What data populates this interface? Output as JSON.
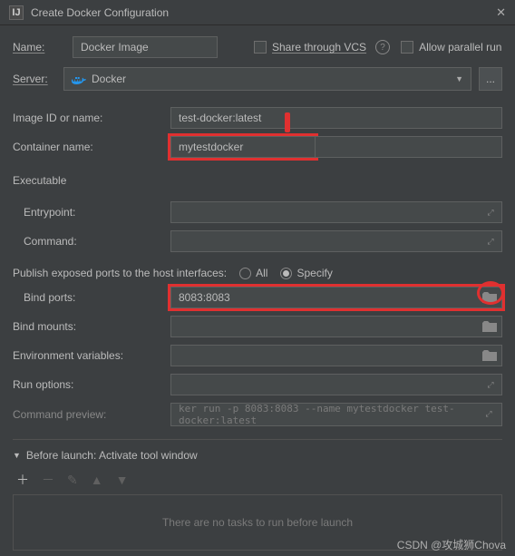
{
  "titlebar": {
    "icon_text": "IJ",
    "title": "Create Docker Configuration",
    "close": "✕"
  },
  "topRow": {
    "name_label": "Name:",
    "name_value": "Docker Image",
    "share_label": "Share through VCS",
    "parallel_label": "Allow parallel run"
  },
  "server": {
    "label": "Server:",
    "value": "Docker",
    "more": "..."
  },
  "fields": {
    "image_id_label": "Image ID or name:",
    "image_id_value": "test-docker:latest",
    "container_name_label": "Container name:",
    "container_name_value": "mytestdocker",
    "executable_label": "Executable",
    "entrypoint_label": "Entrypoint:",
    "entrypoint_value": "",
    "command_label": "Command:",
    "command_value": "",
    "publish_label": "Publish exposed ports to the host interfaces:",
    "radio_all": "All",
    "radio_specify": "Specify",
    "bind_ports_label": "Bind ports:",
    "bind_ports_value": "8083:8083",
    "bind_mounts_label": "Bind mounts:",
    "bind_mounts_value": "",
    "env_label": "Environment variables:",
    "env_value": "",
    "run_options_label": "Run options:",
    "run_options_value": "",
    "cmd_preview_label": "Command preview:",
    "cmd_preview_value": "ker run -p 8083:8083 --name mytestdocker test-docker:latest"
  },
  "beforeLaunch": {
    "header": "Before launch: Activate tool window",
    "empty": "There are no tasks to run before launch"
  },
  "watermark": "CSDN @攻城狮Chova"
}
